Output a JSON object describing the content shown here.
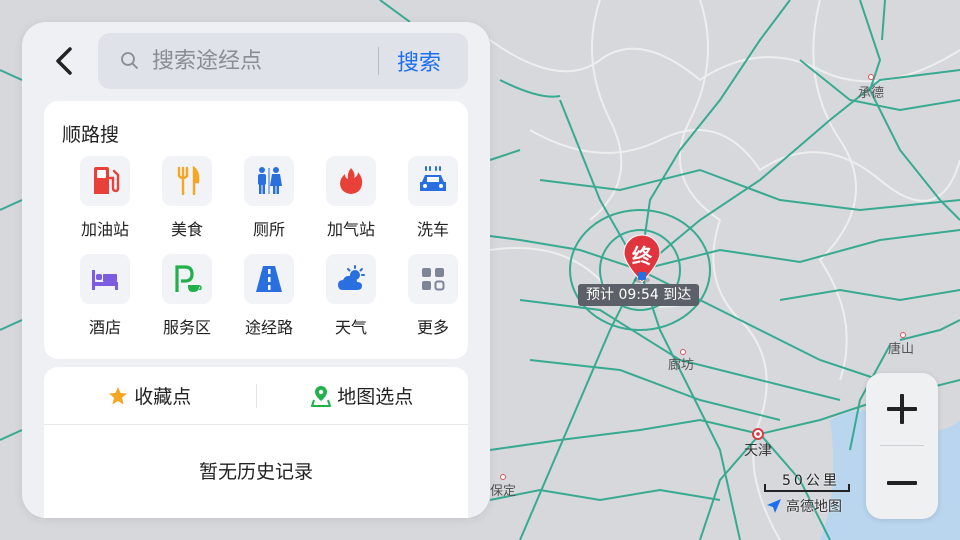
{
  "search": {
    "placeholder": "搜索途经点",
    "button_label": "搜索"
  },
  "category_section": {
    "title": "顺路搜",
    "items": [
      {
        "label": "加油站",
        "icon": "gas-station-icon",
        "color": "#e8413a"
      },
      {
        "label": "美食",
        "icon": "food-icon",
        "color": "#f5a623"
      },
      {
        "label": "厕所",
        "icon": "toilet-icon",
        "color": "#2a6fe0"
      },
      {
        "label": "加气站",
        "icon": "flame-icon",
        "color": "#e8413a"
      },
      {
        "label": "洗车",
        "icon": "car-wash-icon",
        "color": "#2a6fe0"
      },
      {
        "label": "酒店",
        "icon": "hotel-bed-icon",
        "color": "#7c5ce0"
      },
      {
        "label": "服务区",
        "icon": "service-area-icon",
        "color": "#22b04b"
      },
      {
        "label": "途经路",
        "icon": "road-icon",
        "color": "#2a6fe0"
      },
      {
        "label": "天气",
        "icon": "weather-icon",
        "color": "#2a6fe0"
      },
      {
        "label": "更多",
        "icon": "more-grid-icon",
        "color": "#7d8597"
      }
    ]
  },
  "quick_actions": {
    "favorites_label": "收藏点",
    "map_pick_label": "地图选点"
  },
  "history": {
    "empty_label": "暂无历史记录"
  },
  "map": {
    "destination_marker_label": "终",
    "eta_label": "预计 09:54 到达",
    "cities": [
      "承德",
      "廊坊",
      "唐山",
      "天津",
      "保定"
    ],
    "scale_label": "50公里",
    "brand_label": "高德地图"
  },
  "colors": {
    "accent": "#1d6ef0",
    "road": "#2fa88e",
    "marker": "#e0353f"
  }
}
